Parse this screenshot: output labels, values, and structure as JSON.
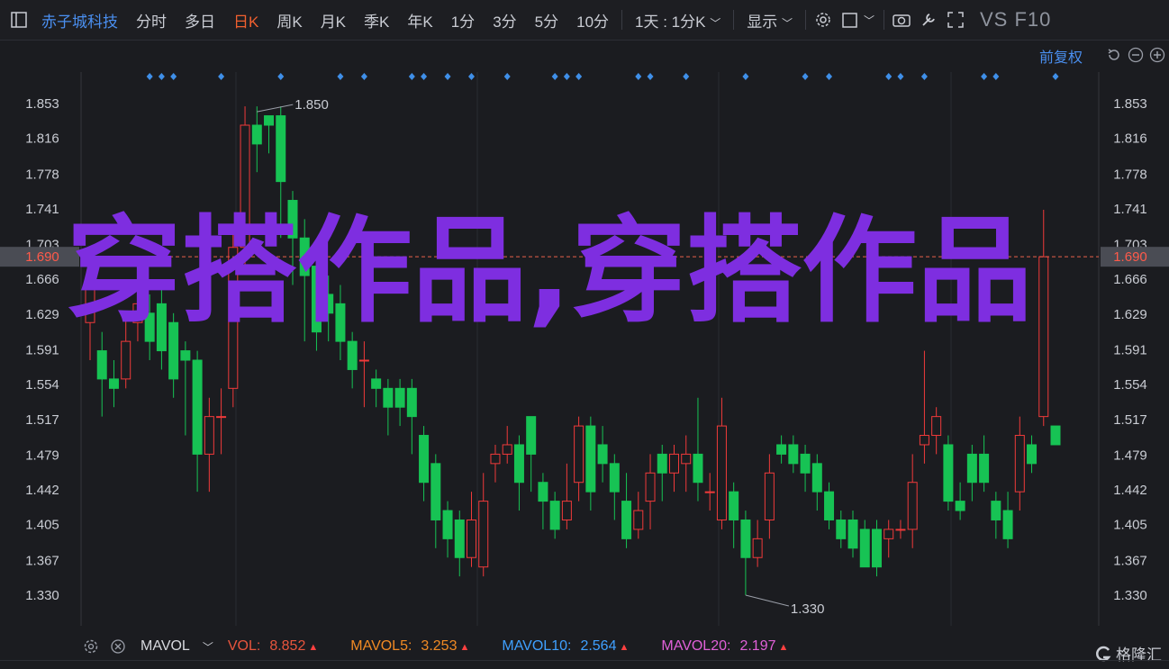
{
  "toolbar": {
    "stock_name": "赤子城科技",
    "periods": [
      "分时",
      "多日",
      "日K",
      "周K",
      "月K",
      "季K",
      "年K",
      "1分",
      "3分",
      "5分",
      "10分"
    ],
    "active_period": "日K",
    "range_select": "1天 : 1分K",
    "display_select": "显示",
    "vs_label": "VS F10"
  },
  "adjust": {
    "label": "前复权"
  },
  "watermark": {
    "text": "穿搭作品,穿搭作品"
  },
  "chart_data": {
    "type": "candlestick",
    "y_ticks": [
      "1.853",
      "1.816",
      "1.778",
      "1.741",
      "1.703",
      "1.666",
      "1.629",
      "1.591",
      "1.554",
      "1.517",
      "1.479",
      "1.442",
      "1.405",
      "1.367",
      "1.330"
    ],
    "ylim": [
      1.3,
      1.88
    ],
    "current_price": "1.690",
    "high_annotation": "1.850",
    "low_annotation": "1.330",
    "candles": [
      [
        1.62,
        1.66,
        1.58,
        1.67
      ],
      [
        1.59,
        1.56,
        1.52,
        1.61
      ],
      [
        1.56,
        1.55,
        1.53,
        1.58
      ],
      [
        1.56,
        1.6,
        1.55,
        1.63
      ],
      [
        1.62,
        1.64,
        1.6,
        1.66
      ],
      [
        1.63,
        1.6,
        1.58,
        1.65
      ],
      [
        1.64,
        1.59,
        1.57,
        1.66
      ],
      [
        1.62,
        1.56,
        1.54,
        1.63
      ],
      [
        1.59,
        1.58,
        1.5,
        1.6
      ],
      [
        1.58,
        1.48,
        1.44,
        1.59
      ],
      [
        1.48,
        1.52,
        1.44,
        1.54
      ],
      [
        1.52,
        1.52,
        1.48,
        1.55
      ],
      [
        1.55,
        1.7,
        1.53,
        1.72
      ],
      [
        1.7,
        1.83,
        1.68,
        1.85
      ],
      [
        1.83,
        1.81,
        1.78,
        1.85
      ],
      [
        1.84,
        1.83,
        1.8,
        1.84
      ],
      [
        1.84,
        1.77,
        1.71,
        1.85
      ],
      [
        1.75,
        1.71,
        1.66,
        1.76
      ],
      [
        1.71,
        1.67,
        1.6,
        1.73
      ],
      [
        1.68,
        1.61,
        1.59,
        1.69
      ],
      [
        1.65,
        1.63,
        1.6,
        1.67
      ],
      [
        1.64,
        1.6,
        1.58,
        1.66
      ],
      [
        1.6,
        1.57,
        1.55,
        1.61
      ],
      [
        1.58,
        1.58,
        1.53,
        1.6
      ],
      [
        1.56,
        1.55,
        1.53,
        1.57
      ],
      [
        1.55,
        1.53,
        1.5,
        1.56
      ],
      [
        1.55,
        1.53,
        1.51,
        1.56
      ],
      [
        1.55,
        1.52,
        1.48,
        1.56
      ],
      [
        1.5,
        1.45,
        1.43,
        1.51
      ],
      [
        1.47,
        1.41,
        1.38,
        1.48
      ],
      [
        1.42,
        1.39,
        1.37,
        1.43
      ],
      [
        1.41,
        1.37,
        1.35,
        1.42
      ],
      [
        1.37,
        1.41,
        1.36,
        1.44
      ],
      [
        1.36,
        1.43,
        1.35,
        1.46
      ],
      [
        1.47,
        1.48,
        1.45,
        1.49
      ],
      [
        1.48,
        1.49,
        1.47,
        1.51
      ],
      [
        1.49,
        1.45,
        1.42,
        1.5
      ],
      [
        1.52,
        1.48,
        1.44,
        1.52
      ],
      [
        1.45,
        1.43,
        1.4,
        1.46
      ],
      [
        1.43,
        1.4,
        1.39,
        1.44
      ],
      [
        1.41,
        1.43,
        1.4,
        1.47
      ],
      [
        1.45,
        1.51,
        1.43,
        1.52
      ],
      [
        1.51,
        1.44,
        1.42,
        1.52
      ],
      [
        1.49,
        1.47,
        1.45,
        1.51
      ],
      [
        1.47,
        1.44,
        1.41,
        1.48
      ],
      [
        1.43,
        1.39,
        1.38,
        1.46
      ],
      [
        1.4,
        1.42,
        1.39,
        1.44
      ],
      [
        1.43,
        1.46,
        1.4,
        1.48
      ],
      [
        1.48,
        1.46,
        1.43,
        1.49
      ],
      [
        1.46,
        1.48,
        1.44,
        1.49
      ],
      [
        1.47,
        1.48,
        1.44,
        1.5
      ],
      [
        1.48,
        1.45,
        1.43,
        1.54
      ],
      [
        1.44,
        1.44,
        1.42,
        1.46
      ],
      [
        1.41,
        1.51,
        1.4,
        1.54
      ],
      [
        1.44,
        1.41,
        1.38,
        1.45
      ],
      [
        1.41,
        1.37,
        1.33,
        1.42
      ],
      [
        1.37,
        1.39,
        1.36,
        1.41
      ],
      [
        1.41,
        1.46,
        1.39,
        1.48
      ],
      [
        1.49,
        1.48,
        1.47,
        1.5
      ],
      [
        1.49,
        1.47,
        1.46,
        1.5
      ],
      [
        1.48,
        1.46,
        1.44,
        1.49
      ],
      [
        1.47,
        1.44,
        1.42,
        1.48
      ],
      [
        1.44,
        1.41,
        1.4,
        1.45
      ],
      [
        1.41,
        1.39,
        1.38,
        1.42
      ],
      [
        1.41,
        1.38,
        1.37,
        1.42
      ],
      [
        1.4,
        1.36,
        1.36,
        1.41
      ],
      [
        1.4,
        1.36,
        1.35,
        1.41
      ],
      [
        1.39,
        1.4,
        1.37,
        1.41
      ],
      [
        1.4,
        1.4,
        1.39,
        1.41
      ],
      [
        1.4,
        1.45,
        1.38,
        1.48
      ],
      [
        1.49,
        1.5,
        1.47,
        1.59
      ],
      [
        1.5,
        1.52,
        1.48,
        1.53
      ],
      [
        1.49,
        1.43,
        1.42,
        1.5
      ],
      [
        1.43,
        1.42,
        1.41,
        1.45
      ],
      [
        1.48,
        1.45,
        1.43,
        1.49
      ],
      [
        1.48,
        1.45,
        1.44,
        1.5
      ],
      [
        1.43,
        1.41,
        1.39,
        1.44
      ],
      [
        1.42,
        1.39,
        1.38,
        1.44
      ],
      [
        1.44,
        1.5,
        1.42,
        1.52
      ],
      [
        1.49,
        1.47,
        1.46,
        1.5
      ],
      [
        1.52,
        1.69,
        1.51,
        1.74
      ],
      [
        1.51,
        1.49,
        1.49,
        1.51
      ]
    ],
    "markers_x_index": [
      5,
      6,
      7,
      11,
      16,
      21,
      23,
      27,
      28,
      30,
      32,
      35,
      39,
      40,
      41,
      46,
      47,
      50,
      55,
      60,
      62,
      67,
      68,
      70,
      75,
      76,
      81
    ]
  },
  "indicators": {
    "vol_name": "MAVOL",
    "items": [
      {
        "label": "VOL:",
        "value": "8.852",
        "color": "#e8553d"
      },
      {
        "label": "MAVOL5:",
        "value": "3.253",
        "color": "#f08a24"
      },
      {
        "label": "MAVOL10:",
        "value": "2.564",
        "color": "#3fa0ff"
      },
      {
        "label": "MAVOL20:",
        "value": "2.197",
        "color": "#e060d8"
      }
    ]
  },
  "brand": {
    "label": "格隆汇"
  },
  "colors": {
    "up": "#f03a3a",
    "down": "#17c354",
    "grid": "#2a2c32",
    "axis_text": "#c9ccd3",
    "price_line": "#e8604a"
  }
}
